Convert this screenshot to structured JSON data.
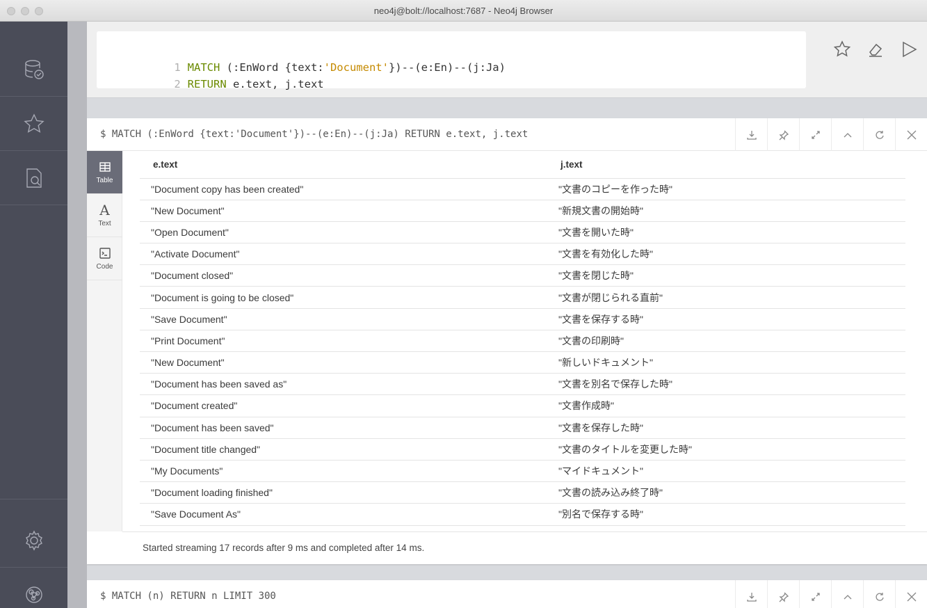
{
  "window": {
    "title": "neo4j@bolt://localhost:7687 - Neo4j Browser"
  },
  "sidebar": {
    "items": [
      {
        "icon": "database-icon"
      },
      {
        "icon": "star-icon"
      },
      {
        "icon": "document-search-icon"
      },
      {
        "icon": "gear-icon"
      },
      {
        "icon": "neo4j-logo-icon"
      }
    ]
  },
  "editor": {
    "line_numbers": [
      "1",
      "2"
    ],
    "line1": {
      "kw": "MATCH",
      "pre": " (:EnWord {text:",
      "str": "'Document'",
      "post": "})--(e:En)--(j:Ja)"
    },
    "line2": {
      "kw": "RETURN",
      "post": " e.text, j.text"
    },
    "actions": [
      "star-icon",
      "eraser-icon",
      "play-icon"
    ]
  },
  "frame1": {
    "command": "$ MATCH (:EnWord {text:'Document'})--(e:En)--(j:Ja) RETURN e.text, j.text",
    "tools": [
      "download-icon",
      "pin-icon",
      "expand-icon",
      "collapse-icon",
      "rerun-icon",
      "close-icon"
    ],
    "views": [
      {
        "label": "Table",
        "icon": "table-icon",
        "active": true
      },
      {
        "label": "Text",
        "icon": "text-icon",
        "active": false
      },
      {
        "label": "Code",
        "icon": "code-icon",
        "active": false
      }
    ],
    "columns": [
      "e.text",
      "j.text"
    ],
    "rows": [
      [
        "\"Document copy has been created\"",
        "\"文書のコピーを作った時\""
      ],
      [
        "\"New Document\"",
        "\"新規文書の開始時\""
      ],
      [
        "\"Open Document\"",
        "\"文書を開いた時\""
      ],
      [
        "\"Activate Document\"",
        "\"文書を有効化した時\""
      ],
      [
        "\"Document closed\"",
        "\"文書を閉じた時\""
      ],
      [
        "\"Document is going to be closed\"",
        "\"文書が閉じられる直前\""
      ],
      [
        "\"Save Document\"",
        "\"文書を保存する時\""
      ],
      [
        "\"Print Document\"",
        "\"文書の印刷時\""
      ],
      [
        "\"New Document\"",
        "\"新しいドキュメント\""
      ],
      [
        "\"Document has been saved as\"",
        "\"文書を別名で保存した時\""
      ],
      [
        "\"Document created\"",
        "\"文書作成時\""
      ],
      [
        "\"Document has been saved\"",
        "\"文書を保存した時\""
      ],
      [
        "\"Document title changed\"",
        "\"文書のタイトルを変更した時\""
      ],
      [
        "\"My Documents\"",
        "\"マイドキュメント\""
      ],
      [
        "\"Document loading finished\"",
        "\"文書の読み込み終了時\""
      ],
      [
        "\"Save Document As\"",
        "\"別名で保存する時\""
      ]
    ],
    "status": "Started streaming 17 records after 9 ms and completed after 14 ms."
  },
  "frame2": {
    "command": "$ MATCH (n) RETURN n LIMIT 300",
    "tools": [
      "download-icon",
      "pin-icon",
      "expand-icon",
      "collapse-icon",
      "rerun-icon",
      "close-icon"
    ]
  }
}
